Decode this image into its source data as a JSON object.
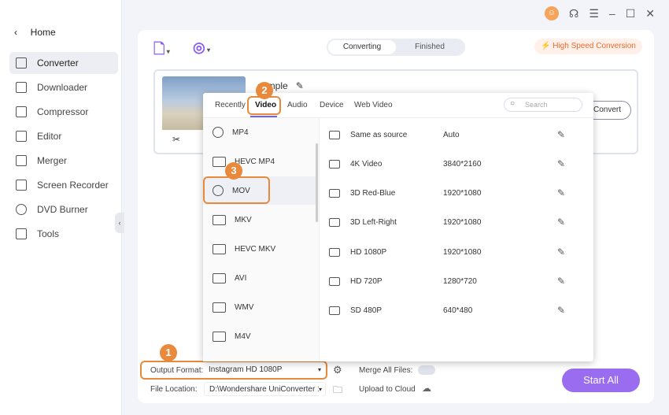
{
  "window": {
    "icons": [
      "avatar-icon",
      "headset-icon",
      "menu-icon",
      "minimize-icon",
      "maximize-icon",
      "close-icon"
    ]
  },
  "sidebar": {
    "home": "Home",
    "items": [
      {
        "label": "Converter",
        "active": true
      },
      {
        "label": "Downloader"
      },
      {
        "label": "Compressor"
      },
      {
        "label": "Editor"
      },
      {
        "label": "Merger"
      },
      {
        "label": "Screen Recorder"
      },
      {
        "label": "DVD Burner"
      },
      {
        "label": "Tools"
      }
    ]
  },
  "header": {
    "tabs": [
      "Converting",
      "Finished"
    ],
    "high_speed": "High Speed Conversion"
  },
  "file": {
    "name": "sample",
    "convert": "Convert"
  },
  "popup": {
    "tabs": [
      "Recently",
      "Video",
      "Audio",
      "Device",
      "Web Video"
    ],
    "active_tab": "Video",
    "search_placeholder": "Search",
    "formats": [
      "MP4",
      "HEVC MP4",
      "MOV",
      "MKV",
      "HEVC MKV",
      "AVI",
      "WMV",
      "M4V"
    ],
    "selected_format": "MOV",
    "resolutions": [
      {
        "name": "Same as source",
        "res": "Auto"
      },
      {
        "name": "4K Video",
        "res": "3840*2160"
      },
      {
        "name": "3D Red-Blue",
        "res": "1920*1080"
      },
      {
        "name": "3D Left-Right",
        "res": "1920*1080"
      },
      {
        "name": "HD 1080P",
        "res": "1920*1080"
      },
      {
        "name": "HD 720P",
        "res": "1280*720"
      },
      {
        "name": "SD 480P",
        "res": "640*480"
      }
    ]
  },
  "steps": [
    "1",
    "2",
    "3"
  ],
  "bottom": {
    "output_label": "Output Format:",
    "output_value": "Instagram HD 1080P",
    "location_label": "File Location:",
    "location_value": "D:\\Wondershare UniConverter 1",
    "merge_label": "Merge All Files:",
    "merge_on": false,
    "upload_label": "Upload to Cloud",
    "start_all": "Start All"
  },
  "colors": {
    "accent": "#9a6cf0",
    "highlight": "#e8893c",
    "high_speed": "#f06a2a"
  }
}
